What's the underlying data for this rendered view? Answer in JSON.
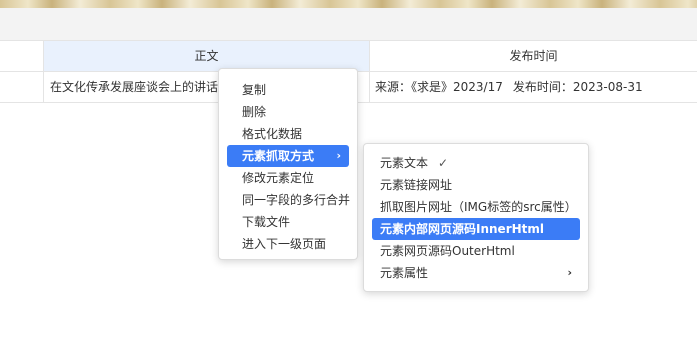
{
  "table": {
    "headers": [
      "",
      "正文",
      "发布时间"
    ],
    "rows": [
      {
        "cell_a": "",
        "cell_b": "在文化传承发展座谈会上的讲话",
        "source": "来源：《求是》2023/17",
        "publish": "发布时间：2023-08-31"
      }
    ]
  },
  "context_menu": {
    "items": [
      {
        "label": "复制"
      },
      {
        "label": "删除"
      },
      {
        "label": "格式化数据"
      },
      {
        "label": "元素抓取方式",
        "active": true,
        "submenu": true
      },
      {
        "label": "修改元素定位"
      },
      {
        "label": "同一字段的多行合并"
      },
      {
        "label": "下载文件"
      },
      {
        "label": "进入下一级页面"
      }
    ]
  },
  "submenu": {
    "items": [
      {
        "label": "元素文本",
        "checked": true
      },
      {
        "label": "元素链接网址"
      },
      {
        "label": "抓取图片网址（IMG标签的src属性）"
      },
      {
        "label": "元素内部网页源码InnerHtml",
        "active": true
      },
      {
        "label": "元素网页源码OuterHtml"
      },
      {
        "label": "元素属性",
        "submenu": true
      }
    ]
  },
  "glyphs": {
    "arrow": "›",
    "check": "✓"
  },
  "colors": {
    "accent": "#3b7cf6",
    "header_highlight": "#e9f1fd"
  }
}
